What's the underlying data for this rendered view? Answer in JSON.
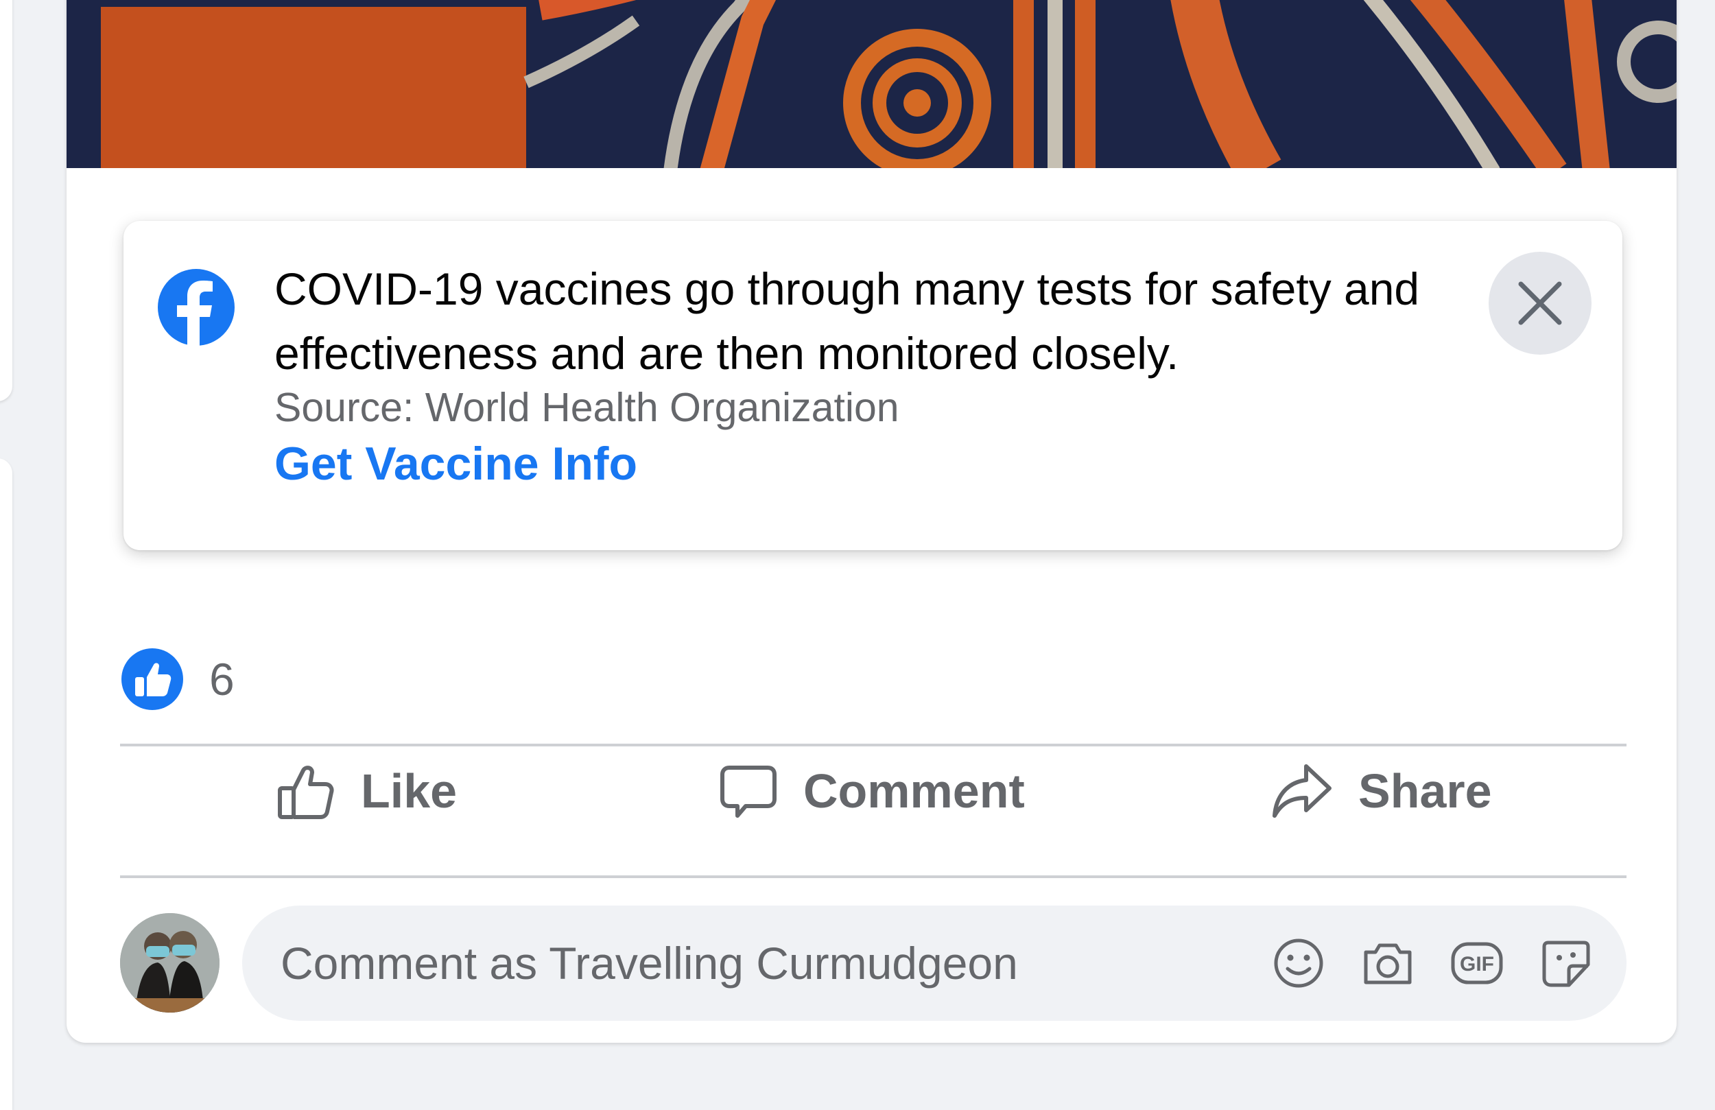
{
  "info_notice": {
    "message": "COVID-19 vaccines go through many tests for safety and effectiveness and are then monitored closely.",
    "source": "Source: World Health Organization",
    "link": "Get Vaccine Info",
    "logo_icon": "facebook-logo-icon",
    "close_icon": "close-icon"
  },
  "reactions": {
    "icon": "like-reaction-icon",
    "count": "6"
  },
  "actions": {
    "like": {
      "label": "Like",
      "icon": "thumbs-up-icon"
    },
    "comment": {
      "label": "Comment",
      "icon": "speech-bubble-icon"
    },
    "share": {
      "label": "Share",
      "icon": "share-arrow-icon"
    }
  },
  "composer": {
    "placeholder": "Comment as Travelling Curmudgeon",
    "icons": [
      "emoji-icon",
      "camera-icon",
      "gif-icon",
      "sticker-icon"
    ]
  },
  "colors": {
    "brand_blue": "#1877f2",
    "secondary_text": "#65676b",
    "background": "#f0f2f5"
  }
}
